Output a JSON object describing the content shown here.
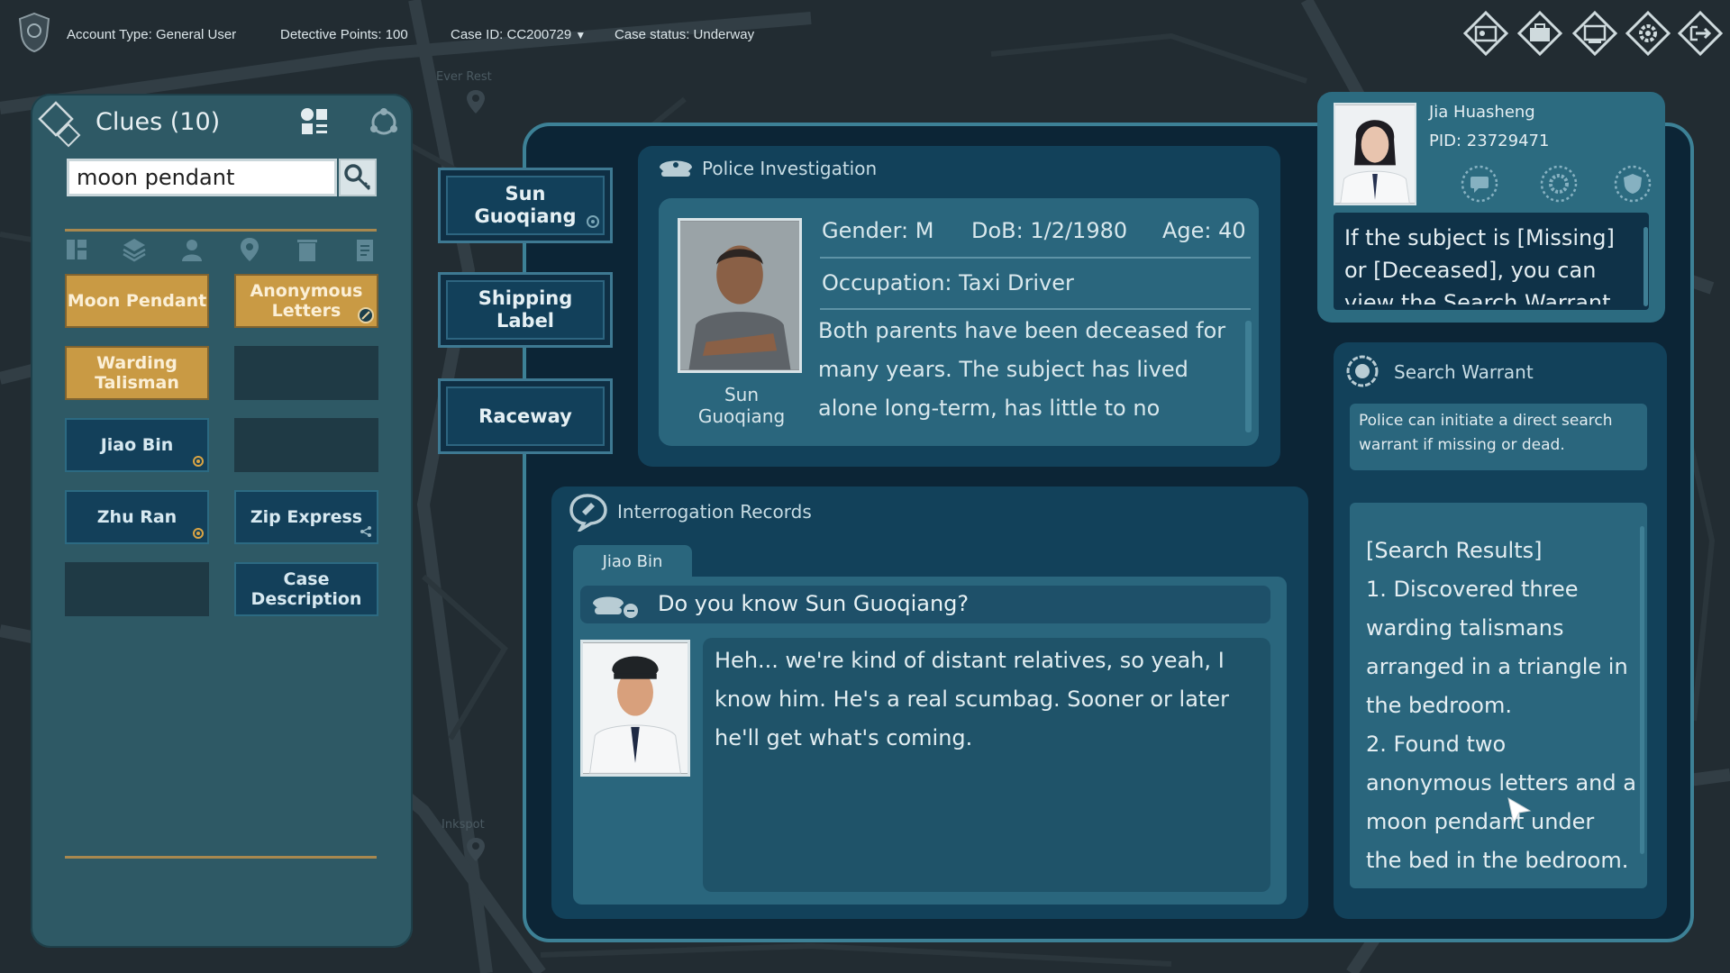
{
  "topbar": {
    "account_type": "Account Type: General User",
    "detective_points": "Detective Points: 100",
    "case_id": "Case ID: CC200729",
    "case_status": "Case status: Underway",
    "icons": [
      "id-card-icon",
      "briefcase-icon",
      "screen-icon",
      "settings-icon",
      "exit-icon"
    ]
  },
  "map_labels": {
    "top": "Ever Rest",
    "bottom": "Inkspot"
  },
  "clues": {
    "title": "Clues",
    "count": "(10)",
    "search_value": "moon pendant",
    "items": [
      {
        "label": "Moon Pendant",
        "style": "gold"
      },
      {
        "label": "Anonymous Letters",
        "style": "gold"
      },
      {
        "label": "Warding Talisman",
        "style": "gold"
      },
      {
        "label": "",
        "style": "empty"
      },
      {
        "label": "Jiao Bin",
        "style": "blue"
      },
      {
        "label": "",
        "style": "empty"
      },
      {
        "label": "Zhu Ran",
        "style": "blue"
      },
      {
        "label": "Zip Express",
        "style": "blue"
      },
      {
        "label": "",
        "style": "empty"
      },
      {
        "label": "Case Description",
        "style": "blue"
      }
    ]
  },
  "subject_tabs": [
    "Sun Guoqiang",
    "Shipping Label",
    "Raceway"
  ],
  "police": {
    "title": "Police Investigation",
    "name": "Sun Guoqiang",
    "gender": "Gender: M",
    "dob": "DoB: 1/2/1980",
    "age": "Age: 40",
    "occupation": "Occupation: Taxi Driver",
    "description": "Both parents have been deceased for many years. The subject has lived alone long-term, has little to no contact with"
  },
  "interrogation": {
    "title": "Interrogation Records",
    "tab": "Jiao Bin",
    "question": "Do you know Sun Guoqiang?",
    "answer": "Heh... we're kind of distant relatives, so yeah, I know him. He's a real scumbag. Sooner or later he'll get what's coming."
  },
  "officer": {
    "name": "Jia Huasheng",
    "pid": "PID: 23729471",
    "message": "If the subject is [Missing] or [Deceased], you can view the Search Warrant results"
  },
  "warrant": {
    "title": "Search Warrant",
    "note": "Police can initiate a direct search warrant if missing or dead.",
    "results": "[Search Results]\n1. Discovered three warding talismans arranged in a triangle in the bedroom.\n2. Found two anonymous letters and a moon pendant under the bed in the bedroom."
  },
  "colors": {
    "accent_gold": "#c99a44",
    "panel_teal": "#2e5965",
    "frame_blue": "#3d8196",
    "dark_navy": "#0c2536"
  }
}
